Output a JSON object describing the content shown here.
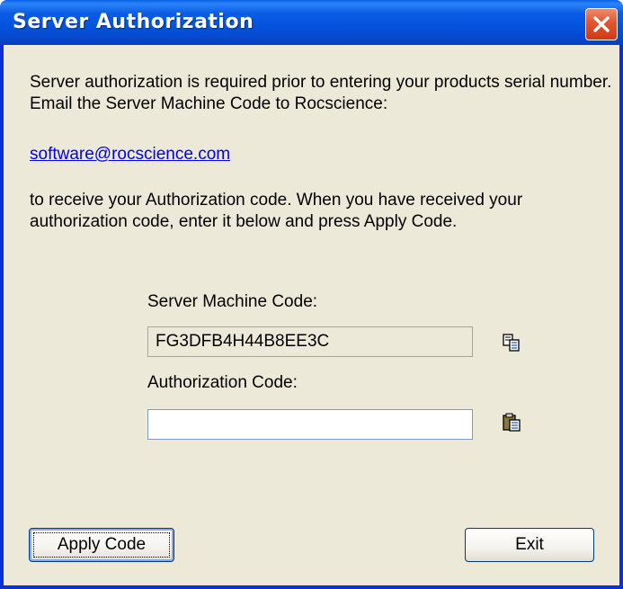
{
  "window": {
    "title": "Server Authorization",
    "close_label": "Close"
  },
  "body": {
    "intro": "Server authorization is required prior to entering your products serial number.  Email the Server Machine Code to Rocscience:",
    "email": "software@rocscience.com",
    "instructions": "to receive your Authorization code.  When you have received your authorization code, enter it below and press Apply Code."
  },
  "server_code": {
    "label": "Server Machine Code:",
    "value": "FG3DFB4H44B8EE3C",
    "copy_icon": "copy-icon"
  },
  "auth_code": {
    "label": "Authorization Code:",
    "value": "",
    "paste_icon": "paste-icon"
  },
  "buttons": {
    "apply": "Apply Code",
    "exit": "Exit"
  },
  "colors": {
    "title_bar": "#0553dd",
    "window_bg": "#ece9d8",
    "close_button": "#e2542f",
    "link": "#0000ee"
  }
}
